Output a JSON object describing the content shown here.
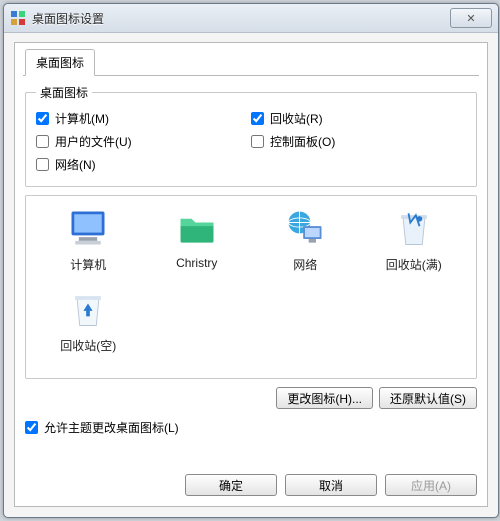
{
  "window": {
    "title": "桌面图标设置",
    "close_glyph": "✕"
  },
  "tab_label": "桌面图标",
  "group_label": "桌面图标",
  "checks": {
    "computer": {
      "label": "计算机(M)",
      "checked": true
    },
    "recycle": {
      "label": "回收站(R)",
      "checked": true
    },
    "userfiles": {
      "label": "用户的文件(U)",
      "checked": false
    },
    "controlpanel": {
      "label": "控制面板(O)",
      "checked": false
    },
    "network": {
      "label": "网络(N)",
      "checked": false
    }
  },
  "icons": {
    "computer": {
      "label": "计算机"
    },
    "userfolder": {
      "label": "Christry"
    },
    "network": {
      "label": "网络"
    },
    "recycle_full": {
      "label": "回收站(满)"
    },
    "recycle_empty": {
      "label": "回收站(空)"
    }
  },
  "buttons": {
    "change_icon": "更改图标(H)...",
    "restore_default": "还原默认值(S)",
    "ok": "确定",
    "cancel": "取消",
    "apply": "应用(A)"
  },
  "allow_theme": {
    "label": "允许主题更改桌面图标(L)",
    "checked": true
  }
}
